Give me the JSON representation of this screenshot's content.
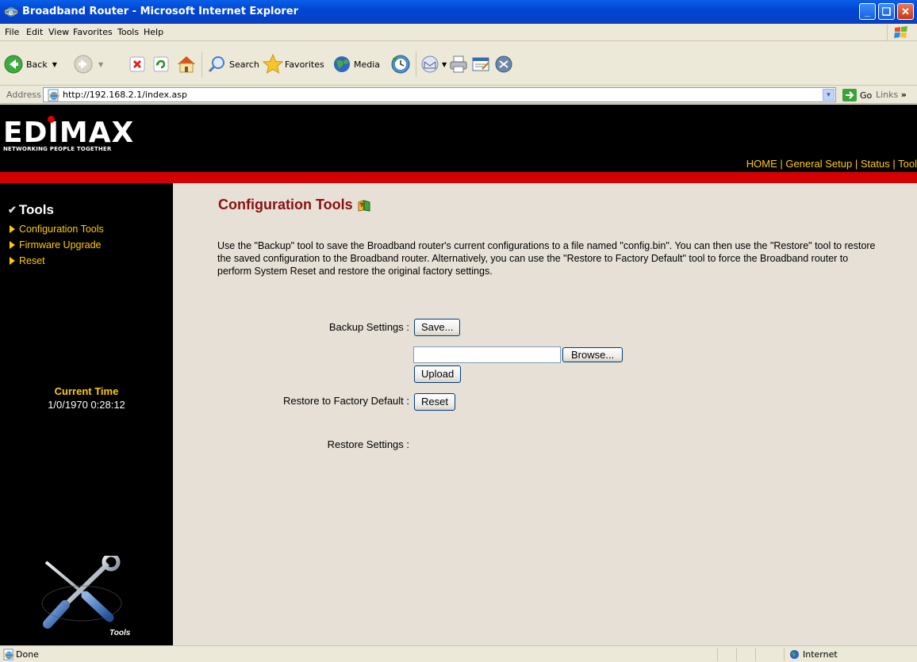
{
  "window": {
    "title": "Broadband Router - Microsoft Internet Explorer",
    "minimize_glyph": "_",
    "restore_glyph": "❏",
    "close_glyph": "✕"
  },
  "menu": [
    "File",
    "Edit",
    "View",
    "Favorites",
    "Tools",
    "Help"
  ],
  "toolbar": {
    "back_label": "Back",
    "search_label": "Search",
    "favorites_label": "Favorites",
    "media_label": "Media"
  },
  "address_bar": {
    "label": "Address",
    "url": "http://192.168.2.1/index.asp",
    "go_label": "Go",
    "links_label": "Links"
  },
  "router": {
    "brand": "EDIMAX",
    "tagline": "NETWORKING PEOPLE TOGETHER",
    "top_nav": [
      "HOME",
      "General Setup",
      "Status",
      "Tool"
    ],
    "sidebar": {
      "section_title": "Tools",
      "links": [
        "Configuration Tools",
        "Firmware Upgrade",
        "Reset"
      ],
      "current_time_label": "Current Time",
      "current_time_value": "1/0/1970 0:28:12",
      "art_caption": "Tools"
    },
    "main": {
      "title": "Configuration Tools",
      "description": "Use the \"Backup\" tool to save the Broadband router's current configurations to a file named \"config.bin\". You can then use the \"Restore\" tool to restore the saved configuration to the Broadband router. Alternatively, you can use the \"Restore to Factory Default\" tool to force the Broadband router to perform System Reset and restore the original factory settings.",
      "backup_label": "Backup Settings :",
      "save_button": "Save...",
      "restore_label": "Restore Settings :",
      "file_value": "",
      "browse_button": "Browse...",
      "upload_button": "Upload",
      "factory_label": "Restore to Factory Default :",
      "reset_button": "Reset"
    }
  },
  "status_bar": {
    "status_text": "Done",
    "zone_text": "Internet"
  },
  "colors": {
    "title_accent": "#8b0f0f",
    "nav_yellow": "#ffcc00",
    "brand_red": "#d20000"
  }
}
